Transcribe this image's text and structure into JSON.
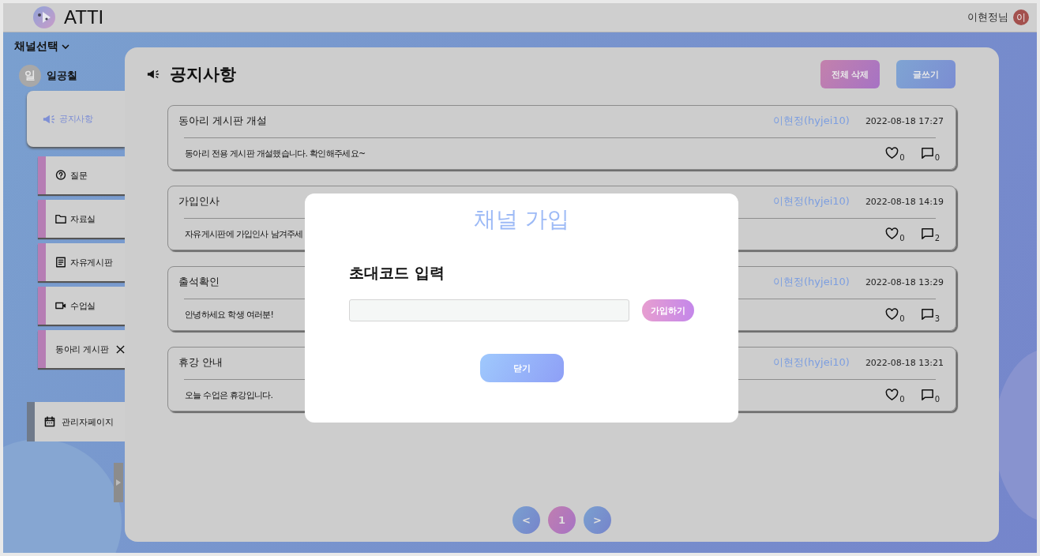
{
  "header": {
    "brand": "ATTI",
    "user_name": "이현정님",
    "user_avatar": "이"
  },
  "sidebar": {
    "channel_select": "채널선택",
    "channel": {
      "avatar": "일",
      "name": "일공칠"
    },
    "items": [
      {
        "label": "공지사항",
        "selected": true,
        "closable": false
      },
      {
        "label": "질문",
        "selected": false,
        "closable": false
      },
      {
        "label": "자료실",
        "selected": false,
        "closable": false
      },
      {
        "label": "자유게시판",
        "selected": false,
        "closable": false
      },
      {
        "label": "수업실",
        "selected": false,
        "closable": false
      },
      {
        "label": "동아리 게시판",
        "selected": false,
        "closable": true
      }
    ],
    "admin_link": "관리자페이지"
  },
  "board": {
    "title": "공지사항",
    "buttons": [
      "전체 삭제",
      "글쓰기"
    ],
    "posts": [
      {
        "title": "동아리 게시판 개설",
        "author": "이현정(hyjei10)",
        "date": "2022-08-18 17:27",
        "body": "동아리 전용 게시판 개설했습니다. 확인해주세요~",
        "likes": "0",
        "comments": "0"
      },
      {
        "title": "가입인사",
        "author": "이현정(hyjei10)",
        "date": "2022-08-18 14:19",
        "body": "자유게시판에 가입인사 남겨주세",
        "likes": "0",
        "comments": "2"
      },
      {
        "title": "출석확인",
        "author": "이현정(hyjei10)",
        "date": "2022-08-18 13:29",
        "body": "안녕하세요 학생 여러분!",
        "likes": "0",
        "comments": "3"
      },
      {
        "title": "휴강 안내",
        "author": "이현정(hyjei10)",
        "date": "2022-08-18 13:21",
        "body": "오늘 수업은 휴강입니다.",
        "likes": "0",
        "comments": "0"
      }
    ],
    "pagination": {
      "prev": "<",
      "pages": [
        {
          "label": "1",
          "selected": true
        }
      ],
      "next": ">"
    }
  },
  "join_dialog": {
    "title": "채널 가입",
    "label": "초대코드 입력",
    "join_button": "가입하기",
    "close_button": "닫기"
  }
}
